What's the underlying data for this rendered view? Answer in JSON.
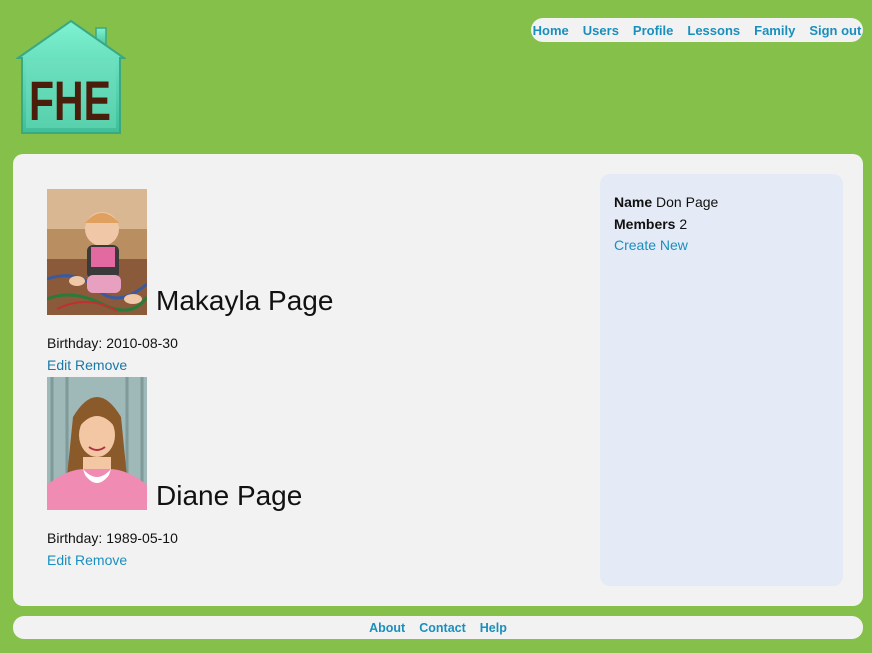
{
  "logo": {
    "text": "FHE"
  },
  "nav": {
    "items": [
      {
        "label": "Home"
      },
      {
        "label": "Users"
      },
      {
        "label": "Profile"
      },
      {
        "label": "Lessons"
      },
      {
        "label": "Family"
      },
      {
        "label": "Sign out"
      }
    ]
  },
  "members": [
    {
      "name": "Makayla Page",
      "birthday_label": "Birthday:",
      "birthday": "2010-08-30",
      "edit_label": "Edit",
      "remove_label": "Remove"
    },
    {
      "name": "Diane Page",
      "birthday_label": "Birthday:",
      "birthday": "1989-05-10",
      "edit_label": "Edit",
      "remove_label": "Remove"
    }
  ],
  "sidebar": {
    "name_label": "Name",
    "name_value": "Don Page",
    "members_label": "Members",
    "members_value": "2",
    "create_label": "Create New"
  },
  "footer": {
    "items": [
      {
        "label": "About"
      },
      {
        "label": "Contact"
      },
      {
        "label": "Help"
      }
    ]
  },
  "colors": {
    "page_bg": "#84c04a",
    "panel_bg": "#f2f2f2",
    "sidebar_bg": "#e4eaf6",
    "link": "#1a8fbe",
    "logo_house": "#5fd6b4",
    "logo_text": "#4a1e0a"
  }
}
